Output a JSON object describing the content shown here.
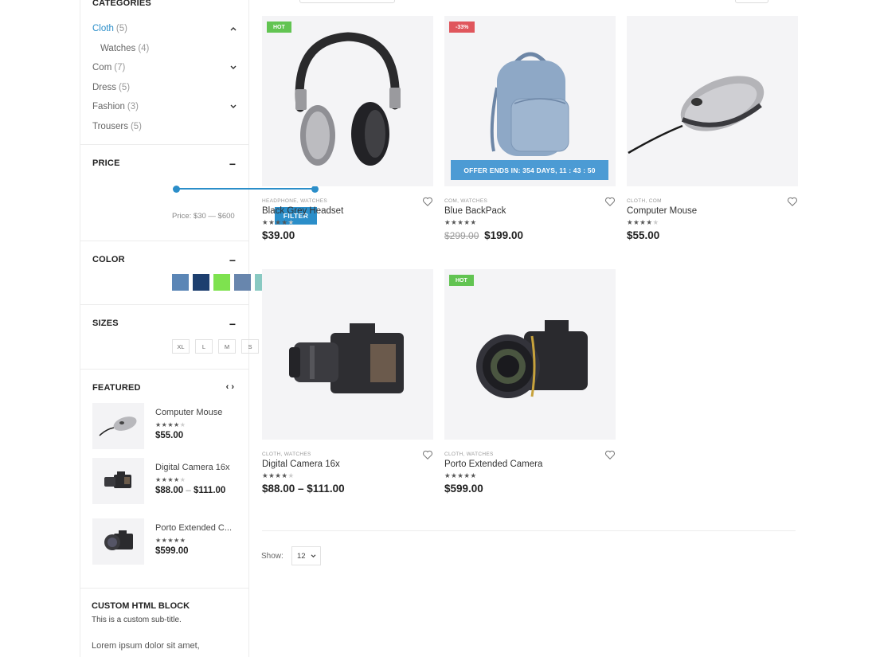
{
  "sidebar": {
    "categories": {
      "title": "CATEGORIES",
      "items": [
        {
          "name": "Cloth",
          "count": "(5)",
          "active": true,
          "chevron": "up"
        },
        {
          "name": "Watches",
          "count": "(4)",
          "sub": true
        },
        {
          "name": "Com",
          "count": "(7)",
          "chevron": "down"
        },
        {
          "name": "Dress",
          "count": "(5)"
        },
        {
          "name": "Fashion",
          "count": "(3)",
          "chevron": "down"
        },
        {
          "name": "Trousers",
          "count": "(5)"
        }
      ]
    },
    "price": {
      "title": "PRICE",
      "label": "Price: $30 — $600",
      "filter_label": "FILTER"
    },
    "color": {
      "title": "COLOR",
      "swatches": [
        "#5b86b6",
        "#1d3f6f",
        "#7ee24f",
        "#6886ad",
        "#89c9c2",
        "#a45a68"
      ]
    },
    "sizes": {
      "title": "SIZES",
      "items": [
        "XL",
        "L",
        "M",
        "S"
      ]
    },
    "featured": {
      "title": "FEATURED",
      "items": [
        {
          "name": "Computer Mouse",
          "price": "$55.00",
          "rating": 4,
          "icon": "mouse-icon"
        },
        {
          "name": "Digital Camera 16x",
          "price_low": "$88.00",
          "price_sep": "–",
          "price_high": "$111.00",
          "rating": 4,
          "icon": "camera-icon"
        },
        {
          "name": "Porto Extended C...",
          "price": "$599.00",
          "rating": 5,
          "icon": "camera-icon"
        }
      ]
    },
    "custom": {
      "title": "CUSTOM HTML BLOCK",
      "subtitle": "This is a custom sub-title.",
      "body": "Lorem ipsum dolor sit amet,"
    }
  },
  "products": [
    {
      "badge": "HOT",
      "badge_type": "hot",
      "cats": "HEADPHONE, WATCHES",
      "name": "Black Grey Headset",
      "rating": 4,
      "price": "$39.00",
      "image": "headphones-icon"
    },
    {
      "badge": "-33%",
      "badge_type": "sale",
      "cats": "COM, WATCHES",
      "name": "Blue BackPack",
      "rating": 5,
      "old_price": "$299.00",
      "price": "$199.00",
      "offer": "OFFER ENDS IN: 354 DAYS, 11 : 43 : 50",
      "image": "backpack-icon"
    },
    {
      "cats": "CLOTH, COM",
      "name": "Computer Mouse",
      "rating": 4,
      "price": "$55.00",
      "image": "mouse-icon"
    },
    {
      "cats": "CLOTH, WATCHES",
      "name": "Digital Camera 16x",
      "rating": 4,
      "price": "$88.00 – $111.00",
      "image": "camera-icon"
    },
    {
      "badge": "HOT",
      "badge_type": "hot",
      "cats": "CLOTH, WATCHES",
      "name": "Porto Extended Camera",
      "rating": 5,
      "price": "$599.00",
      "image": "camera-icon"
    }
  ],
  "pagination": {
    "show_label": "Show:",
    "per_page": "12"
  }
}
